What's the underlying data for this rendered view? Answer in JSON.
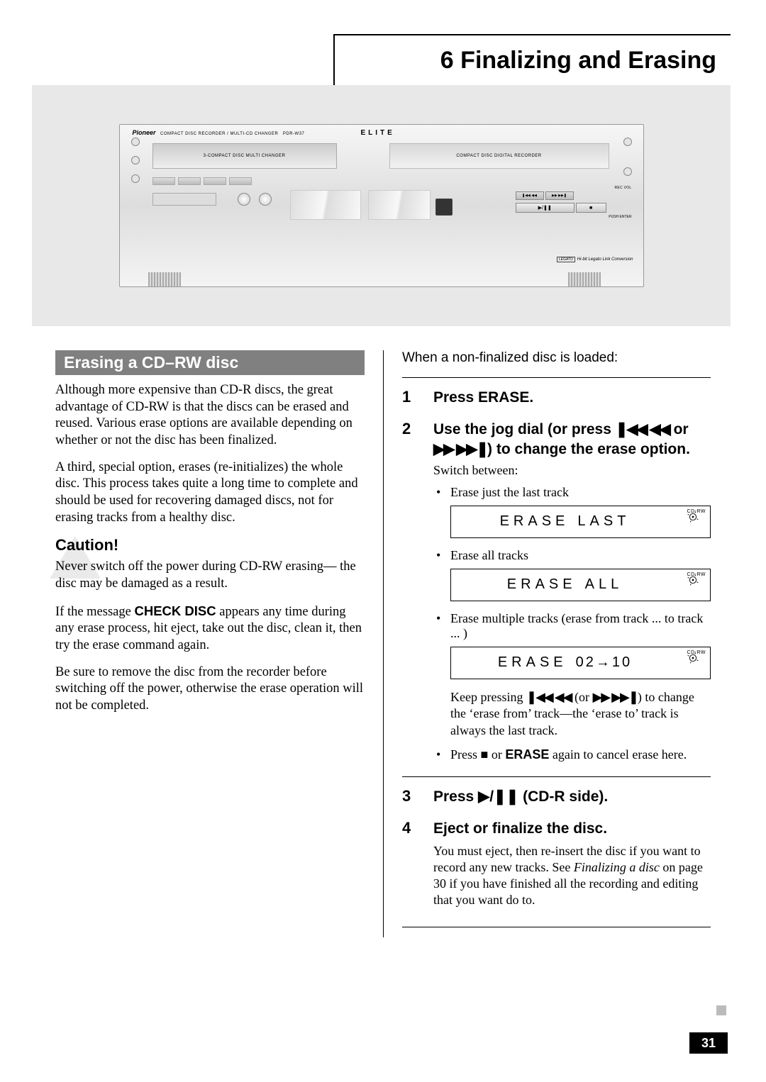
{
  "chapter": {
    "num": "6",
    "title": "Finalizing and Erasing"
  },
  "device": {
    "brand": "Pioneer",
    "desc": "COMPACT DISC RECORDER / MULTI-CD CHANGER",
    "model": "PDR-W37",
    "elite": "ELITE",
    "tray_left": "3-COMPACT DISC MULTI CHANGER",
    "tray_right": "COMPACT DISC DIGITAL RECORDER",
    "rec_vol": "REC VOL",
    "push_enter": "PUSH ENTER",
    "play_pause": "▶/❚❚",
    "stop": "■",
    "prev": "❚◀◀ ◀◀",
    "next": "▶▶ ▶▶❚",
    "legato_badge": "LEGATO",
    "legato": "Hi-bit Legato Link Conversion"
  },
  "section_title": "Erasing a CD–RW disc",
  "left": {
    "p1": "Although more expensive than CD-R discs, the great advantage of CD-RW is that the discs can be erased and reused. Various erase options are available depending on whether or not the disc has been finalized.",
    "p2": "A third, special option, erases (re-initializes) the whole disc. This process takes quite a long time to complete and should be used for recovering damaged discs, not for erasing tracks from a healthy disc.",
    "caution": "Caution!",
    "p3": "Never switch off the power during CD-RW erasing— the disc may be damaged as a result.",
    "p4a": "If the message ",
    "p4b": "CHECK DISC",
    "p4c": " appears any time during any erase process, hit eject, take out the disc, clean it, then try the erase command again.",
    "p5": "Be sure to remove the disc from the recorder before switching off the power, otherwise the erase operation will not be completed."
  },
  "right": {
    "lead": "When a non-finalized disc is loaded:",
    "step1": "Press ERASE.",
    "step2a": "Use the jog dial (or press ",
    "step2_nav1": "❚◀◀ ◀◀",
    "step2b": " or ",
    "step2_nav2": "▶▶ ▶▶❚",
    "step2c": ") to change the erase option.",
    "step2_sub": "Switch between:",
    "b1": "Erase just the last track",
    "disp1a": "ERASE",
    "disp1b": "LAST",
    "b2": "Erase all tracks",
    "disp2a": "ERASE",
    "disp2b": "ALL",
    "b3": "Erase multiple tracks (erase from track ... to track ... )",
    "disp3a": "ERASE",
    "disp3b": "02→10",
    "note1a": "Keep pressing ",
    "note1_nav1": "❚◀◀ ◀◀",
    "note1b": " (or ",
    "note1_nav2": "▶▶ ▶▶❚",
    "note1c": ") to change the ‘erase from’ track—the ‘erase to’ track is always the last track.",
    "b4a": "Press ",
    "b4_stop": "■",
    "b4b": " or ",
    "b4_erase": "ERASE",
    "b4c": " again to cancel erase here.",
    "step3a": "Press ",
    "step3_play": "▶/❚❚",
    "step3b": " (CD-R side).",
    "step4": "Eject or finalize the disc.",
    "step4_body_a": "You must eject, then re-insert the disc if you want to record any new tracks. See ",
    "step4_body_b": "Finalizing a disc",
    "step4_body_c": " on page 30 if you have finished all the recording and editing that you want do to.",
    "cdrw": "CD-RW"
  },
  "page_number": "31"
}
